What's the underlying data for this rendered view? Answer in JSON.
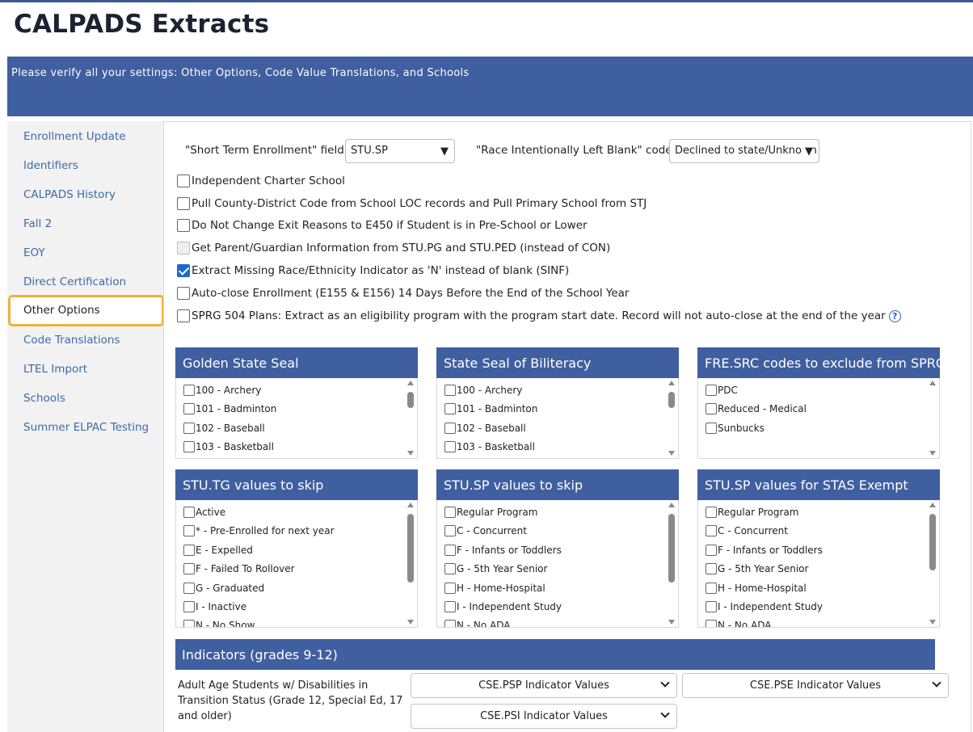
{
  "title": "CALPADS Extracts",
  "banner": "Please verify all your settings: Other Options, Code Value Translations, and Schools",
  "sidebar": {
    "items": [
      "Enrollment Update",
      "Identifiers",
      "CALPADS History",
      "Fall 2",
      "EOY",
      "Direct Certification",
      "Other Options",
      "Code Translations",
      "LTEL Import",
      "Schools",
      "Summer ELPAC Testing"
    ],
    "active": "Other Options"
  },
  "fields": {
    "short_term_label": "\"Short Term Enrollment\" field:",
    "short_term_value": "STU.SP",
    "race_label": "\"Race Intentionally Left Blank\" code:",
    "race_value": "Declined to state/Unknown"
  },
  "options": [
    {
      "label": "Independent Charter School",
      "checked": false
    },
    {
      "label": "Pull County-District Code from School LOC records and Pull Primary School from STJ",
      "checked": false
    },
    {
      "label": "Do Not Change Exit Reasons to E450 if Student is in Pre-School or Lower",
      "checked": false
    },
    {
      "label": "Get Parent/Guardian Information from STU.PG and STU.PED (instead of CON)",
      "checked": false,
      "disabled": true
    },
    {
      "label": "Extract Missing Race/Ethnicity Indicator as 'N' instead of blank (SINF)",
      "checked": true
    },
    {
      "label": "Auto-close Enrollment (E155 & E156) 14 Days Before the End of the School Year",
      "checked": false
    },
    {
      "label": "SPRG 504 Plans: Extract as an eligibility program with the program start date. Record will not auto-close at the end of the year",
      "checked": false
    }
  ],
  "help_icon": "?",
  "panels": [
    {
      "title": "Golden State Seal",
      "items": [
        "100 - Archery",
        "101 - Badminton",
        "102 - Baseball",
        "103 - Basketball"
      ]
    },
    {
      "title": "State Seal of Biliteracy",
      "items": [
        "100 - Archery",
        "101 - Badminton",
        "102 - Baseball",
        "103 - Basketball"
      ]
    },
    {
      "title": "FRE.SRC codes to exclude from SPRG",
      "items": [
        "PDC",
        "Reduced - Medical",
        "Sunbucks"
      ]
    },
    {
      "title": "STU.TG values to skip",
      "items": [
        "Active",
        "* - Pre-Enrolled for next year",
        "E - Expelled",
        "F - Failed To Rollover",
        "G - Graduated",
        "I - Inactive",
        "N - No Show"
      ]
    },
    {
      "title": "STU.SP values to skip",
      "items": [
        "Regular Program",
        "C - Concurrent",
        "F - Infants or Toddlers",
        "G - 5th Year Senior",
        "H - Home-Hospital",
        "I - Independent Study",
        "N - No ADA"
      ]
    },
    {
      "title": "STU.SP values for STAS Exempt",
      "items": [
        "Regular Program",
        "C - Concurrent",
        "F - Infants or Toddlers",
        "G - 5th Year Senior",
        "H - Home-Hospital",
        "I - Independent Study",
        "N - No ADA"
      ]
    }
  ],
  "indicators": {
    "title": "Indicators  (grades 9-12)",
    "row_label": "Adult Age Students w/ Disabilities in Transition Status (Grade 12, Special Ed, 17 and older)",
    "dropdowns": [
      "CSE.PSP Indicator Values",
      "CSE.PSE Indicator Values",
      "CSE.PSI Indicator Values"
    ]
  }
}
